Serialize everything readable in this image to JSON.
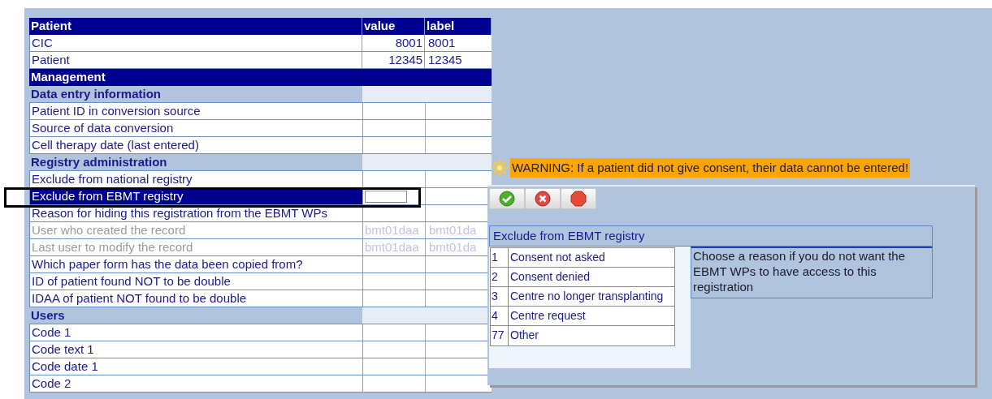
{
  "table": {
    "columns": [
      "Patient",
      "value",
      "label"
    ],
    "rows": [
      {
        "kind": "group",
        "label": "Management"
      },
      {
        "kind": "section",
        "label": "Data entry information"
      },
      {
        "kind": "field",
        "label": "Patient ID in conversion source",
        "selected": false,
        "disabled": false
      },
      {
        "kind": "field",
        "label": "Source of data conversion",
        "selected": false,
        "disabled": false
      },
      {
        "kind": "field",
        "label": "Cell therapy date (last entered)",
        "selected": false,
        "disabled": false
      },
      {
        "kind": "section",
        "label": "Registry administration"
      },
      {
        "kind": "field",
        "label": "Exclude from national registry",
        "selected": false,
        "disabled": false
      },
      {
        "kind": "field",
        "label": "Exclude from EBMT registry",
        "selected": true,
        "disabled": false,
        "input": true
      },
      {
        "kind": "field",
        "label": "Reason for hiding this registration from the EBMT WPs",
        "selected": false,
        "disabled": false
      },
      {
        "kind": "field",
        "label": "User who created the record",
        "value": "bmt01daa",
        "value_label": "bmt01da",
        "selected": false,
        "disabled": true
      },
      {
        "kind": "field",
        "label": "Last user to modify the record",
        "value": "bmt01daa",
        "value_label": "bmt01da",
        "selected": false,
        "disabled": true
      },
      {
        "kind": "field",
        "label": "Which paper form has the data been copied from?",
        "selected": false,
        "disabled": false
      },
      {
        "kind": "field",
        "label": "ID of patient found NOT to be double",
        "selected": false,
        "disabled": false
      },
      {
        "kind": "field",
        "label": "IDAA of patient NOT found to be double",
        "selected": false,
        "disabled": false
      },
      {
        "kind": "section",
        "label": "Users"
      },
      {
        "kind": "field",
        "label": "Code 1",
        "selected": false,
        "disabled": false
      },
      {
        "kind": "field",
        "label": "Code text 1",
        "selected": false,
        "disabled": false
      },
      {
        "kind": "field",
        "label": "Code date 1",
        "selected": false,
        "disabled": false
      },
      {
        "kind": "field",
        "label": "Code 2",
        "selected": false,
        "disabled": false
      }
    ],
    "top_rows": [
      {
        "label": "CIC",
        "value": "8001",
        "value_label": "8001"
      },
      {
        "label": "Patient",
        "value": "12345",
        "value_label": "12345"
      }
    ]
  },
  "warning": "WARNING: If a patient did not give consent, their data cannot be entered!",
  "dialog": {
    "buttons": [
      {
        "kind": "ok"
      },
      {
        "kind": "cancel"
      },
      {
        "kind": "stop"
      }
    ],
    "title": "Exclude from EBMT registry",
    "options": [
      {
        "code": "1",
        "label": "Consent not asked"
      },
      {
        "code": "2",
        "label": "Consent denied"
      },
      {
        "code": "3",
        "label": "Centre no longer transplanting"
      },
      {
        "code": "4",
        "label": "Centre request"
      },
      {
        "code": "77",
        "label": "Other"
      }
    ],
    "description": "Choose a reason if you do not want the EBMT WPs to have access to this registration"
  }
}
